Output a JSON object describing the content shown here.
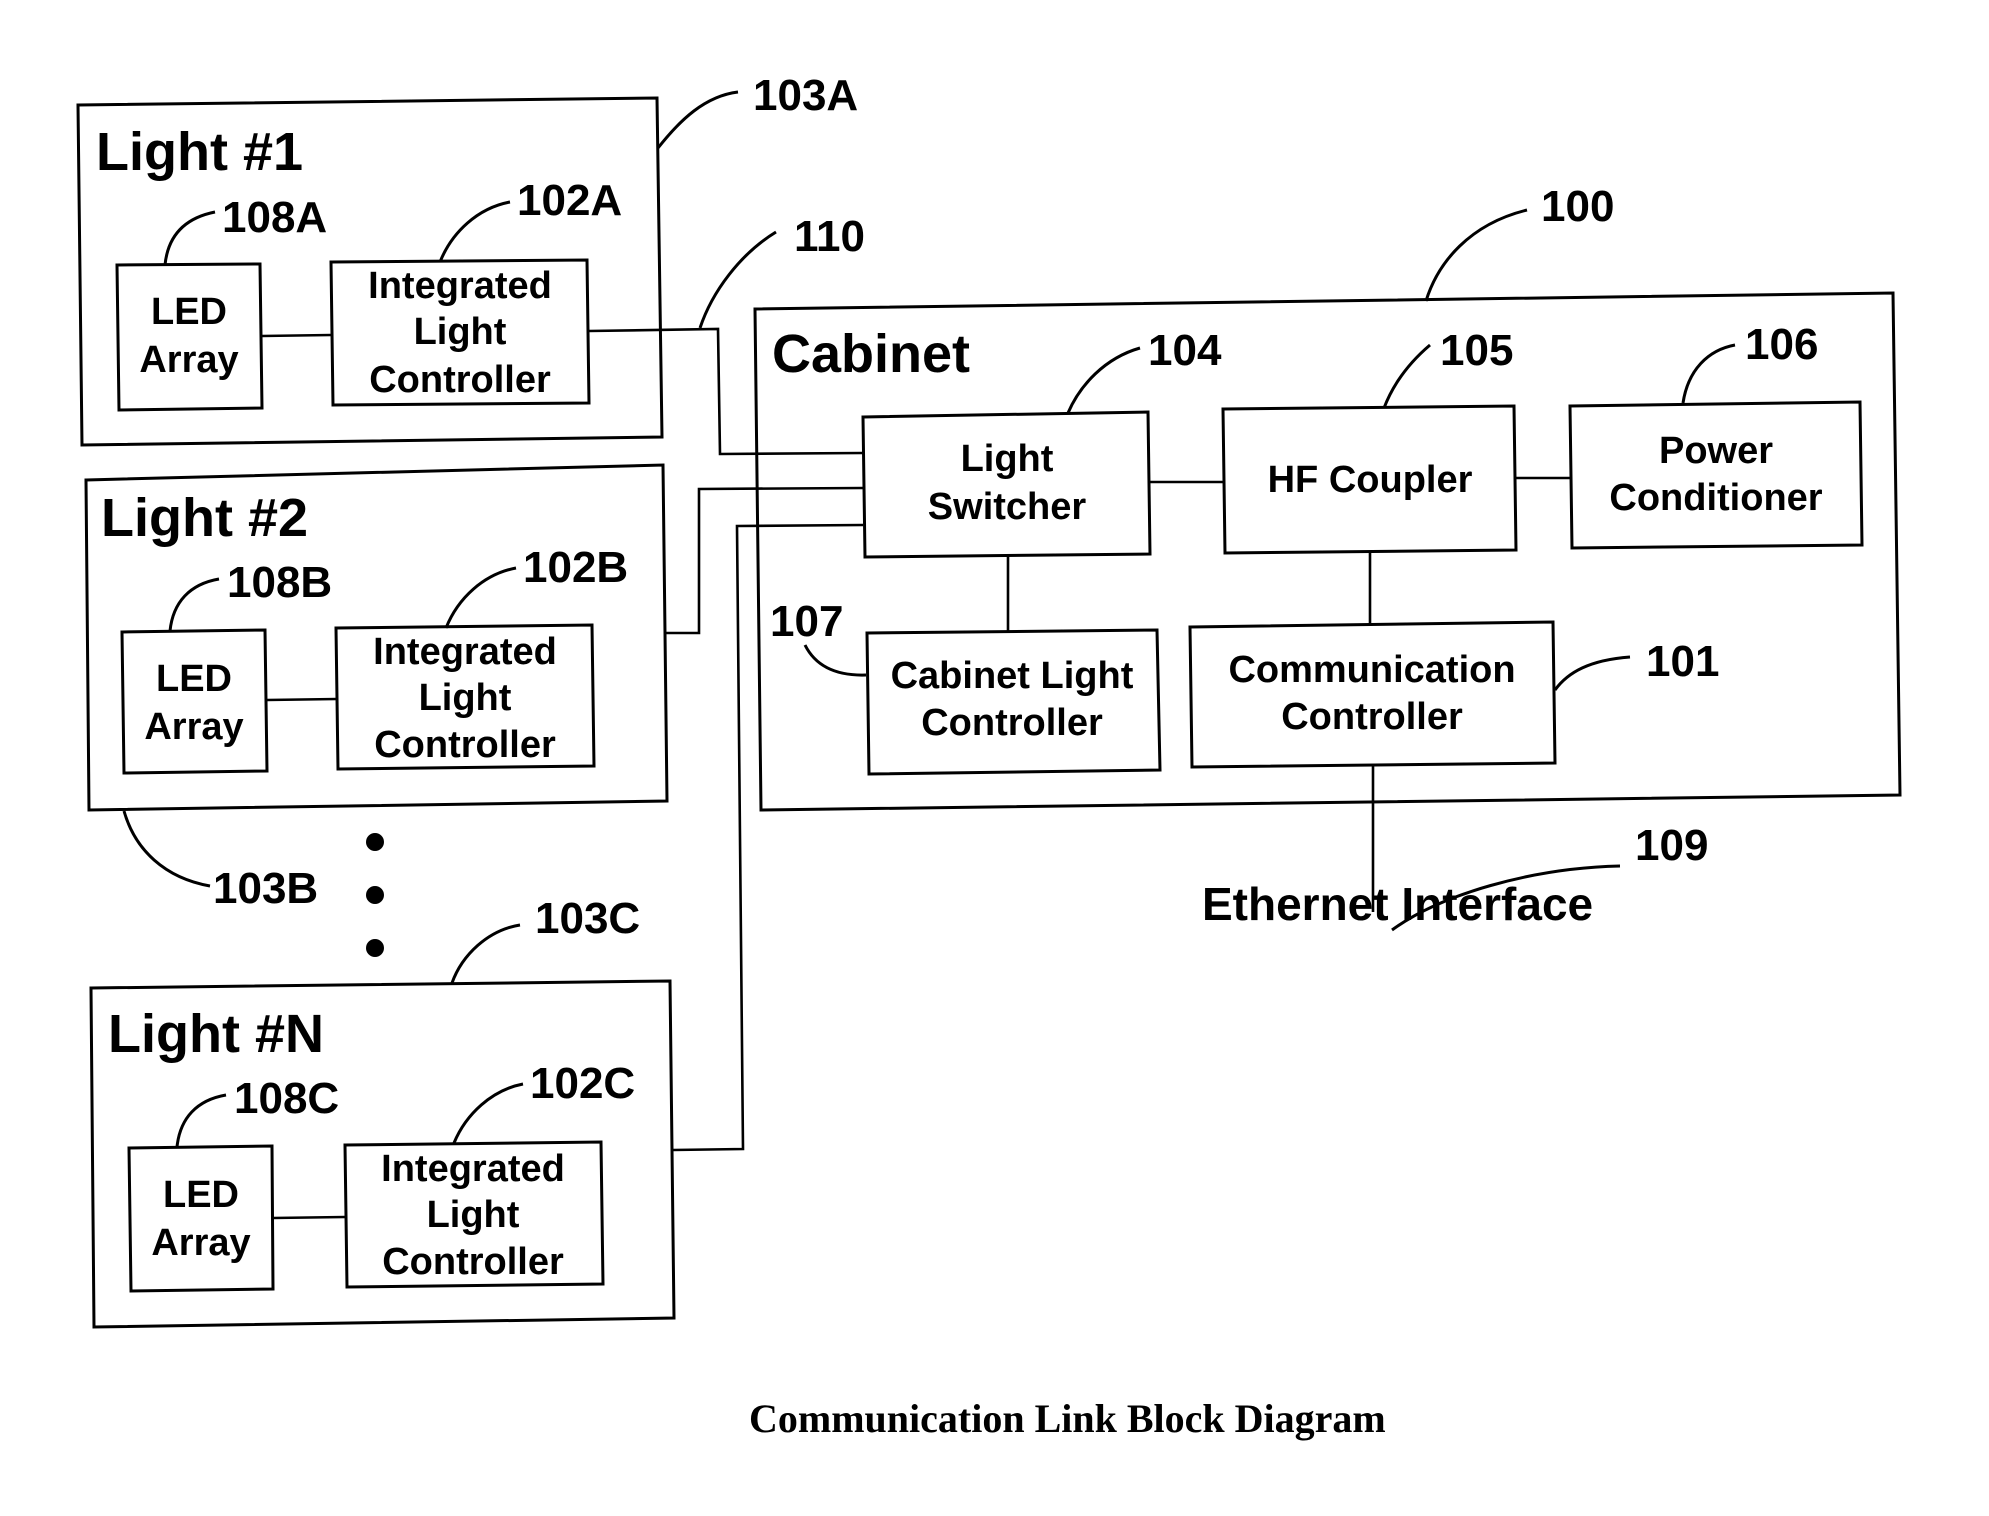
{
  "diagram": {
    "caption": "Communication Link Block Diagram",
    "lights": [
      {
        "title": "Light #1",
        "ref": "103A",
        "led_array": {
          "lines": [
            "LED",
            "Array"
          ],
          "ref": "108A"
        },
        "controller": {
          "lines": [
            "Integrated",
            "Light",
            "Controller"
          ],
          "ref": "102A"
        }
      },
      {
        "title": "Light #2",
        "ref": "103B",
        "led_array": {
          "lines": [
            "LED",
            "Array"
          ],
          "ref": "108B"
        },
        "controller": {
          "lines": [
            "Integrated",
            "Light",
            "Controller"
          ],
          "ref": "102B"
        }
      },
      {
        "title": "Light #N",
        "ref": "103C",
        "led_array": {
          "lines": [
            "LED",
            "Array"
          ],
          "ref": "108C"
        },
        "controller": {
          "lines": [
            "Integrated",
            "Light",
            "Controller"
          ],
          "ref": "102C"
        }
      }
    ],
    "link_ref": "110",
    "cabinet": {
      "title": "Cabinet",
      "ref": "100",
      "light_switcher": {
        "lines": [
          "Light",
          "Switcher"
        ],
        "ref": "104"
      },
      "hf_coupler": {
        "lines": [
          "HF Coupler"
        ],
        "ref": "105"
      },
      "power_conditioner": {
        "lines": [
          "Power",
          "Conditioner"
        ],
        "ref": "106"
      },
      "cabinet_light_controller": {
        "lines": [
          "Cabinet Light",
          "Controller"
        ],
        "ref": "107"
      },
      "communication_controller": {
        "lines": [
          "Communication",
          "Controller"
        ],
        "ref": "101"
      }
    },
    "ethernet": {
      "label": "Ethernet Interface",
      "ref": "109"
    }
  }
}
